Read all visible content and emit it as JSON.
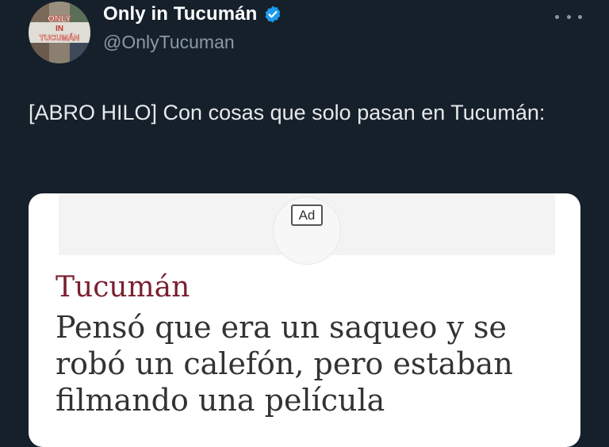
{
  "author": {
    "display_name": "Only in Tucumán",
    "handle": "@OnlyTucuman",
    "verified": true,
    "avatar_text": [
      "ONLY",
      "IN",
      "TUCUMÁN"
    ]
  },
  "tweet": {
    "text": "[ABRO HILO] Con cosas que solo pasan en Tucumán:"
  },
  "media": {
    "ad_label": "Ad",
    "section": "Tucumán",
    "headline": "Pensó que era un saqueo y se robó un calefón, pero estaban filmando una película"
  },
  "colors": {
    "background": "#15202b",
    "verified": "#1d9bf0",
    "section": "#7a1f2f"
  },
  "icons": {
    "more": "more-horizontal-icon",
    "verified": "verified-badge-icon"
  }
}
